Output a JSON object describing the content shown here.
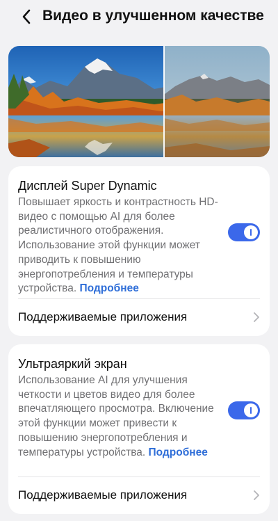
{
  "header": {
    "title": "Видео в улучшенном качестве"
  },
  "icons": {
    "back": "chevron-left-icon",
    "row_arrow": "chevron-right-icon"
  },
  "colors": {
    "accent": "#3b68ea",
    "link": "#2f6ed8",
    "background": "#f2f2f4",
    "card": "#ffffff"
  },
  "cards": [
    {
      "title": "Дисплей Super Dynamic",
      "description": "Повышает яркость и контрастность HD-видео с помощью AI для более реалистичного отображения. Использование этой функции может приводить к повышению энергопотребления и температуры устройства.",
      "link": "Подробнее",
      "toggle_on": true,
      "row_label": "Поддерживаемые приложения"
    },
    {
      "title": "Ультраяркий экран",
      "description": "Использование AI для улучшения четкости и цветов видео для более впечатляющего просмотра. Включение этой функции может привести к повышению энергопотребления и температуры устройства.",
      "link": "Подробнее",
      "toggle_on": true,
      "row_label": "Поддерживаемые приложения"
    }
  ]
}
